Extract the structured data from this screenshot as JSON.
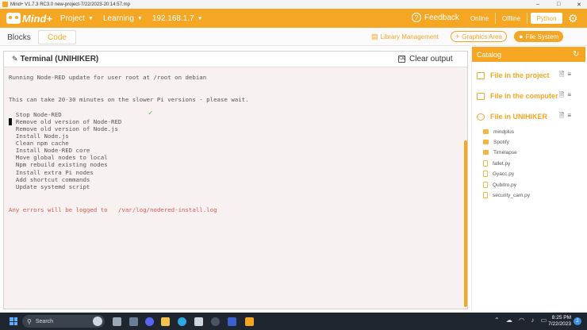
{
  "window": {
    "title": "Mind+ V1.7.3 RC3.0   new-project-7/22/2023-20:14:57.mp",
    "controls": [
      "–",
      "□",
      "✕"
    ]
  },
  "topbar": {
    "logo": "Mind+",
    "menus": [
      "Project",
      "Learning",
      "192.168.1.7"
    ],
    "feedback": "Feedback",
    "modes": [
      "Online",
      "Offline",
      "Python"
    ],
    "active_mode": "Python"
  },
  "tabs": {
    "blocks": "Blocks",
    "code": "Code"
  },
  "tools": {
    "library": "Library Management",
    "graphics": "Graphics Area",
    "filesystem": "File System"
  },
  "terminal": {
    "title": "Terminal (UNIHIKER)",
    "clear": "Clear output",
    "intro": "Running Node-RED update for user root at /root on debian",
    "wait": "This can take 20-30 minutes on the slower Pi versions - please wait.",
    "steps": [
      "  Stop Node-RED",
      "  Remove old version of Node-RED",
      "  Remove old version of Node.js",
      "  Install Node.js",
      "  Clean npm cache",
      "  Install Node-RED core",
      "  Move global nodes to local",
      "  Npm rebuild existing nodes",
      "  Install extra Pi nodes",
      "  Add shortcut commands",
      "  Update systemd script"
    ],
    "check": "✓",
    "error_note": "Any errors will be logged to   /var/log/nodered-install.log"
  },
  "catalog": {
    "title": "Catalog",
    "sections": [
      "File in the project",
      "File in the computer",
      "File in UNIHIKER"
    ],
    "files": [
      {
        "name": "mindplus",
        "type": "folder"
      },
      {
        "name": "Spotify",
        "type": "folder"
      },
      {
        "name": "Timelapse",
        "type": "folder"
      },
      {
        "name": "fallet.py",
        "type": "py"
      },
      {
        "name": "Gyacc.py",
        "type": "py"
      },
      {
        "name": "Qubitro.py",
        "type": "py"
      },
      {
        "name": "security_cam.py",
        "type": "py"
      }
    ]
  },
  "taskbar": {
    "search": "Search",
    "time": "8:25 PM",
    "date": "7/22/2023",
    "notifications": "2"
  },
  "colors": {
    "accent": "#f5a623",
    "terminal_bg": "#f8f1f1",
    "error_text": "#e0554a",
    "check": "#4caf50"
  }
}
